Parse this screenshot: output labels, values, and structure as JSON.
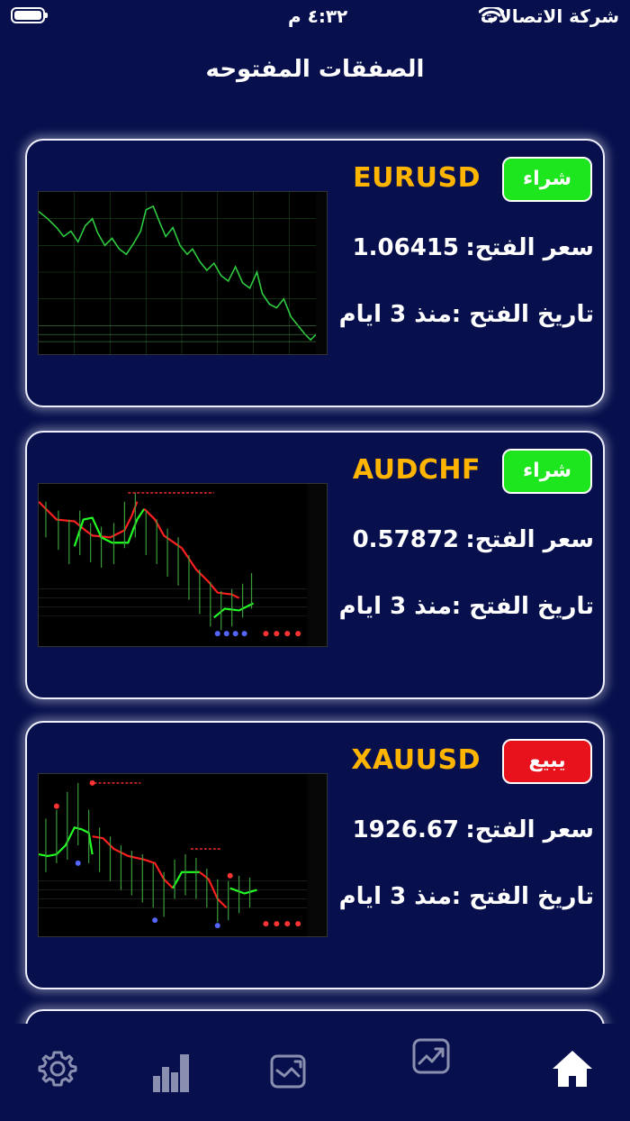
{
  "status_bar": {
    "time": "٤:٣٢ م",
    "carrier": "شركة الاتصالات"
  },
  "page": {
    "title": "الصفقات المفتوحه"
  },
  "labels": {
    "open_price": "سعر الفتح:",
    "open_date": "تاريخ الفتح :"
  },
  "trades": [
    {
      "symbol": "EURUSD",
      "side": "شراء",
      "side_type": "buy",
      "open_price": "1.06415",
      "open_date": "منذ 3 ايام"
    },
    {
      "symbol": "AUDCHF",
      "side": "شراء",
      "side_type": "buy",
      "open_price": "0.57872",
      "open_date": "منذ 3 ايام"
    },
    {
      "symbol": "XAUUSD",
      "side": "يبيع",
      "side_type": "sell",
      "open_price": "1926.67",
      "open_date": "منذ 3 ايام"
    }
  ],
  "tab_bar": {
    "items": [
      "settings-icon",
      "stats-icon",
      "gallery-icon",
      "trending-icon",
      "home-icon"
    ],
    "active": "home-icon"
  },
  "colors": {
    "background": "#07104d",
    "symbol": "#ffb400",
    "buy": "#1ee61e",
    "sell": "#e8121d"
  }
}
